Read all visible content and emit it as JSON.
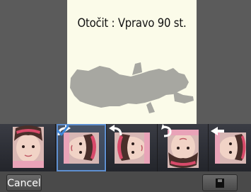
{
  "preview": {
    "rotation_label": "Otočit : Vpravo 90 st.",
    "background_color": "#fbfbe9"
  },
  "thumbnails": [
    {
      "name": "thumb-original",
      "icon": "none"
    },
    {
      "name": "thumb-rotate-right",
      "icon": "rotate-right-icon",
      "selected": true
    },
    {
      "name": "thumb-rotate-left",
      "icon": "rotate-left-icon"
    },
    {
      "name": "thumb-rotate-180",
      "icon": "rotate-180-icon"
    },
    {
      "name": "thumb-flip",
      "icon": "flip-horizontal-icon"
    }
  ],
  "bottom_bar": {
    "cancel_label": "Cancel",
    "save_icon": "floppy-disk-icon"
  },
  "colors": {
    "selection": "#5e8fd0",
    "checkmark": "#3f86d8"
  }
}
